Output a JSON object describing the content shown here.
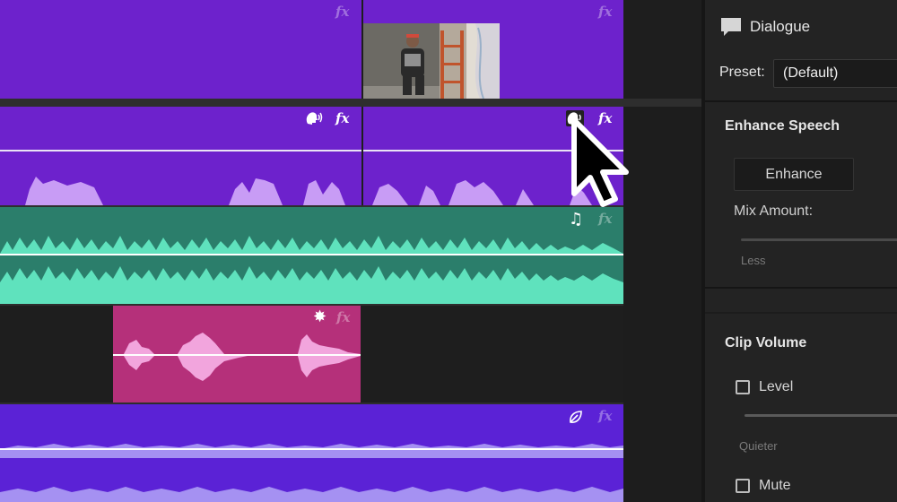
{
  "timeline": {
    "video_track": {
      "fx_label": "fx"
    },
    "dialogue_track": {
      "fx_label": "fx",
      "speech_icon": "speaking-head-icon"
    },
    "music_track": {
      "fx_label": "fx",
      "music_icon": "music-note-icon"
    },
    "sfx_track": {
      "fx_label": "fx",
      "sfx_icon": "sparkle-icon"
    },
    "ambience_track": {
      "fx_label": "fx",
      "ambience_icon": "leaf-icon"
    },
    "colors": {
      "video": "#6d22cc",
      "dialogue": "#6d22cc",
      "music": "#2b7e6b",
      "music_wave": "#5fe2bd",
      "sfx": "#b5307a",
      "sfx_wave": "#f2a5dd",
      "ambience": "#5b22d6",
      "ambience_wave": "#a591f2",
      "dialogue_wave": "#c89cf5"
    }
  },
  "panel": {
    "title": "Dialogue",
    "title_icon": "speech-bubble-icon",
    "preset_label": "Preset:",
    "preset_value": "(Default)",
    "enhance_heading": "Enhance Speech",
    "enhance_button": "Enhance",
    "mix_label": "Mix Amount:",
    "mix_min_label": "Less",
    "clip_volume_heading": "Clip Volume",
    "level_label": "Level",
    "level_min_label": "Quieter",
    "mute_label": "Mute"
  },
  "cursor": {
    "icon": "arrow-cursor-icon"
  }
}
